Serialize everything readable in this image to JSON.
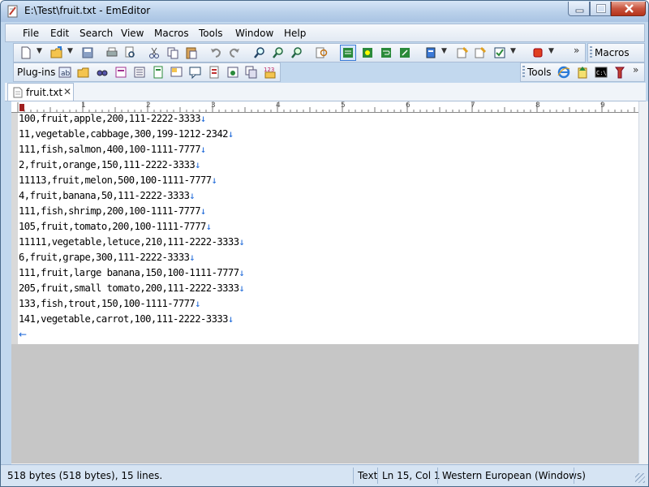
{
  "window": {
    "title": "E:\\Test\\fruit.txt - EmEditor"
  },
  "menu": [
    "File",
    "Edit",
    "Search",
    "View",
    "Macros",
    "Tools",
    "Window",
    "Help"
  ],
  "toolbars": {
    "macros_label": "Macros",
    "plugins_label": "Plug-ins",
    "tools_label": "Tools",
    "overflow_glyph": "»"
  },
  "tab": {
    "label": "fruit.txt",
    "close_glyph": "✕"
  },
  "ruler": {
    "labels": [
      "1",
      "2",
      "3",
      "4",
      "5",
      "6",
      "7",
      "8",
      "9"
    ]
  },
  "document": {
    "lines": [
      "100,fruit,apple,200,111-2222-3333",
      "11,vegetable,cabbage,300,199-1212-2342",
      "111,fish,salmon,400,100-1111-7777",
      "2,fruit,orange,150,111-2222-3333",
      "11113,fruit,melon,500,100-1111-7777",
      "4,fruit,banana,50,111-2222-3333",
      "111,fish,shrimp,200,100-1111-7777",
      "105,fruit,tomato,200,100-1111-7777",
      "11111,vegetable,letuce,210,111-2222-3333",
      "6,fruit,grape,300,111-2222-3333",
      "111,fruit,large banana,150,100-1111-7777",
      "205,fruit,small tomato,200,111-2222-3333",
      "133,fish,trout,150,100-1111-7777",
      "141,vegetable,carrot,100,111-2222-3333"
    ],
    "eol_glyph": "↓",
    "eof_glyph": "←"
  },
  "status": {
    "size": "518 bytes (518 bytes), 15 lines.",
    "mode": "Text",
    "position": "Ln 15, Col 1",
    "encoding": "Western European (Windows)"
  },
  "colors": {
    "eol_marker": "#1a66d8",
    "titlebar": "#b9d0ea",
    "close_button": "#c8553f"
  }
}
